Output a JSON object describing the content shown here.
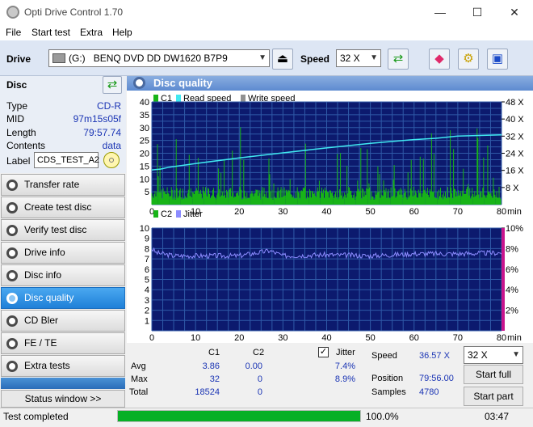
{
  "window": {
    "title": "Opti Drive Control 1.70",
    "minimize": "—",
    "maximize": "☐",
    "close": "✕"
  },
  "menu": [
    "File",
    "Start test",
    "Extra",
    "Help"
  ],
  "drive": {
    "label": "Drive",
    "letter": "(G:)",
    "model": "BENQ DVD DD DW1620 B7P9",
    "speed_label": "Speed",
    "speed_value": "32 X"
  },
  "disc": {
    "header": "Disc",
    "rows": [
      {
        "label": "Type",
        "value": "CD-R"
      },
      {
        "label": "MID",
        "value": "97m15s05f"
      },
      {
        "label": "Length",
        "value": "79:57.74"
      },
      {
        "label": "Contents",
        "value": "data"
      }
    ],
    "label_caption": "Label",
    "label_value": "CDS_TEST_A2"
  },
  "nav": [
    {
      "label": "Transfer rate",
      "active": false
    },
    {
      "label": "Create test disc",
      "active": false
    },
    {
      "label": "Verify test disc",
      "active": false
    },
    {
      "label": "Drive info",
      "active": false
    },
    {
      "label": "Disc info",
      "active": false
    },
    {
      "label": "Disc quality",
      "active": true
    },
    {
      "label": "CD Bler",
      "active": false
    },
    {
      "label": "FE / TE",
      "active": false
    },
    {
      "label": "Extra tests",
      "active": false
    }
  ],
  "status_window_button": "Status window >>",
  "panel_title": "Disc quality",
  "chart_data": [
    {
      "type": "line",
      "legend": [
        {
          "name": "C1",
          "color": "#18b418"
        },
        {
          "name": "Read speed",
          "color": "#40e8f0"
        },
        {
          "name": "Write speed",
          "color": "#909090"
        }
      ],
      "xlim": [
        0,
        80
      ],
      "x_unit": "min",
      "x_ticks": [
        "0",
        "10",
        "20",
        "30",
        "40",
        "50",
        "60",
        "70",
        "80"
      ],
      "ylim": [
        0,
        40
      ],
      "y_ticks": [
        "5",
        "10",
        "15",
        "20",
        "25",
        "30",
        "35",
        "40"
      ],
      "y2_ticks": [
        "8 X",
        "16 X",
        "24 X",
        "32 X",
        "40 X",
        "48 X"
      ],
      "series": [
        {
          "name": "Read speed",
          "unit": "X",
          "x": [
            0,
            2,
            4,
            10,
            20,
            30,
            40,
            50,
            60,
            65,
            70,
            75,
            80
          ],
          "values": [
            16.2,
            16.6,
            17.5,
            19.2,
            21.8,
            24.2,
            26.5,
            28.6,
            30.4,
            31.0,
            32.0,
            32.3,
            32.6
          ]
        },
        {
          "name": "C1",
          "avg": 3.86,
          "max": 32,
          "total": 18524
        }
      ],
      "grid": true
    },
    {
      "type": "line",
      "legend": [
        {
          "name": "C2",
          "color": "#18b418"
        },
        {
          "name": "Jitter",
          "color": "#8c8cff"
        }
      ],
      "xlim": [
        0,
        80
      ],
      "x_unit": "min",
      "x_ticks": [
        "0",
        "10",
        "20",
        "30",
        "40",
        "50",
        "60",
        "70",
        "80"
      ],
      "ylim": [
        0,
        10
      ],
      "y_ticks": [
        "1",
        "2",
        "3",
        "4",
        "5",
        "6",
        "7",
        "8",
        "9",
        "10"
      ],
      "y2_ticks": [
        "2%",
        "4%",
        "6%",
        "8%",
        "10%"
      ],
      "series": [
        {
          "name": "C2",
          "avg": 0.0,
          "max": 0,
          "total": 0
        },
        {
          "name": "Jitter",
          "unit": "%",
          "x": [
            0,
            1,
            5,
            10,
            20,
            27,
            30,
            40,
            50,
            60,
            70,
            80
          ],
          "values": [
            8.0,
            7.6,
            7.3,
            7.3,
            7.3,
            7.8,
            7.3,
            7.4,
            7.3,
            7.5,
            7.5,
            7.6
          ]
        }
      ],
      "grid": true
    }
  ],
  "stats": {
    "col_c1": "C1",
    "col_c2": "C2",
    "jitter_label": "Jitter",
    "jitter_checked": true,
    "rows": [
      {
        "label": "Avg",
        "c1": "3.86",
        "c2": "0.00",
        "jitter": "7.4%"
      },
      {
        "label": "Max",
        "c1": "32",
        "c2": "0",
        "jitter": "8.9%"
      },
      {
        "label": "Total",
        "c1": "18524",
        "c2": "0"
      }
    ],
    "speed_label": "Speed",
    "speed_value": "36.57 X",
    "position_label": "Position",
    "position_value": "79:56.00",
    "samples_label": "Samples",
    "samples_value": "4780",
    "speed_select": "32 X",
    "start_full": "Start full",
    "start_part": "Start part"
  },
  "status": {
    "text": "Test completed",
    "progress": 1.0,
    "percent": "100.0%",
    "time": "03:47"
  }
}
